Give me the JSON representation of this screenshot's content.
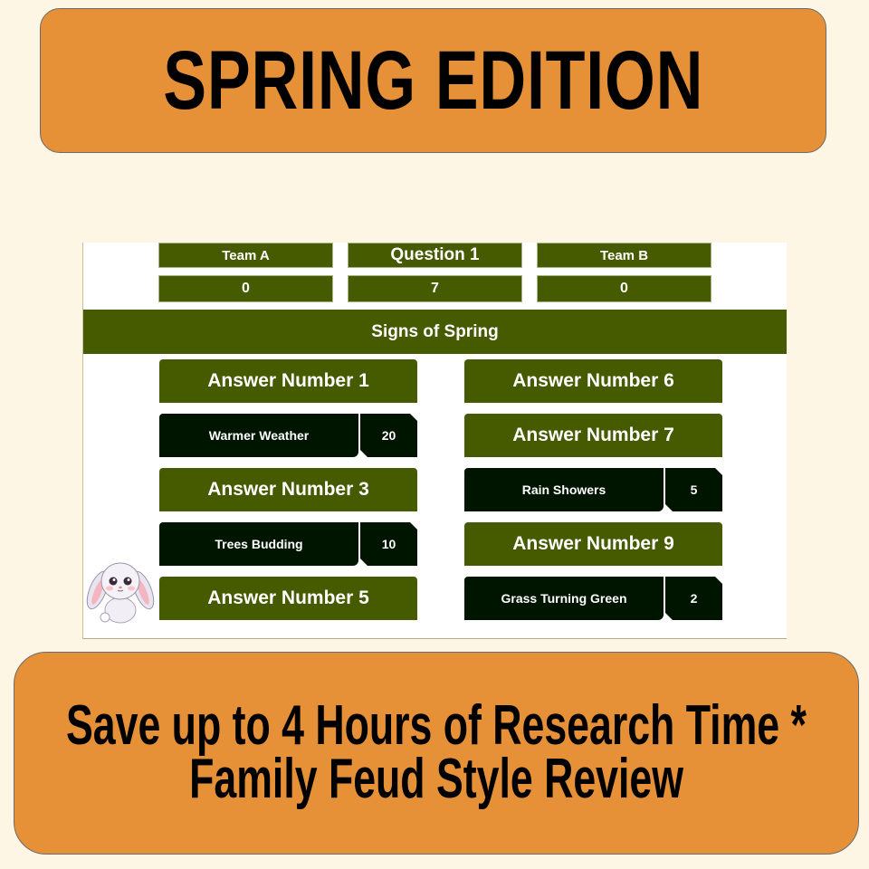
{
  "top_banner": {
    "title": "SPRING EDITION"
  },
  "board": {
    "header": {
      "team_a_label": "Team A",
      "question_label": "Question 1",
      "team_b_label": "Team B",
      "team_a_score": "0",
      "question_value": "7",
      "team_b_score": "0"
    },
    "topic": "Signs of Spring",
    "left_answers": [
      {
        "state": "hidden",
        "label": "Answer Number 1"
      },
      {
        "state": "revealed",
        "answer": "Warmer Weather",
        "points": "20"
      },
      {
        "state": "hidden",
        "label": "Answer Number 3"
      },
      {
        "state": "revealed",
        "answer": "Trees Budding",
        "points": "10"
      },
      {
        "state": "hidden",
        "label": "Answer Number 5"
      }
    ],
    "right_answers": [
      {
        "state": "hidden",
        "label": "Answer Number 6"
      },
      {
        "state": "hidden",
        "label": "Answer Number 7"
      },
      {
        "state": "revealed",
        "answer": "Rain Showers",
        "points": "5"
      },
      {
        "state": "hidden",
        "label": "Answer Number 9"
      },
      {
        "state": "revealed",
        "answer": "Grass Turning Green",
        "points": "2"
      }
    ],
    "mascot_icon": "bunny-icon"
  },
  "bottom_banner": {
    "line1": "Save up to 4 Hours of Research Time *",
    "line2": "Family Feud Style Review"
  },
  "colors": {
    "background": "#fef6e4",
    "banner": "#e69038",
    "board_green": "#465a00",
    "revealed_dark": "#001500"
  }
}
